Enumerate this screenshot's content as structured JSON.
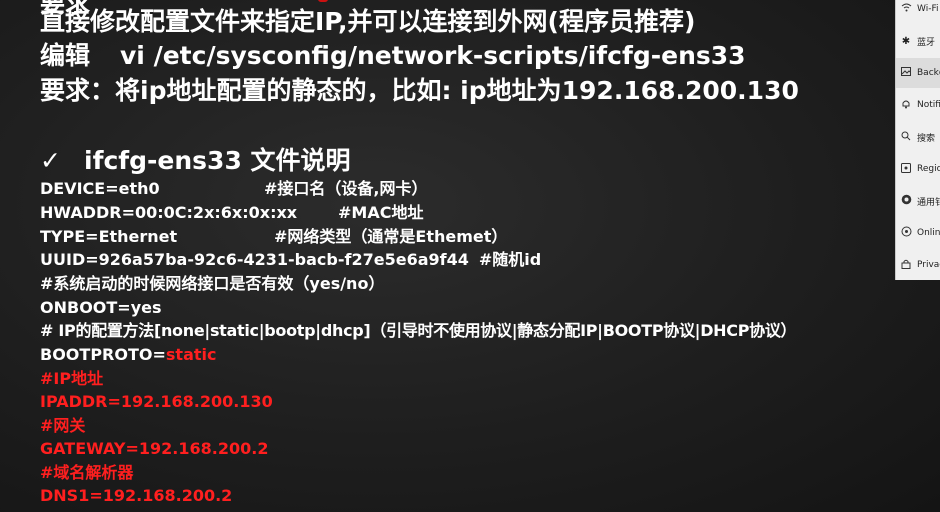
{
  "slide": {
    "top_partial": "要求",
    "line1": "直接修改配置文件来指定IP,并可以连接到外网(程序员推荐)",
    "line2_label": "编辑",
    "line2_value": "vi /etc/sysconfig/network-scripts/ifcfg-ens33",
    "line3": "要求：将ip地址配置的静态的，比如: ip地址为192.168.200.130",
    "check_mark": "✓",
    "section_title": "ifcfg-ens33 文件说明",
    "config": [
      {
        "text": "DEVICE=eth0",
        "comment": "#接口名（设备,网卡）"
      },
      {
        "text": "HWADDR=00:0C:2x:6x:0x:xx",
        "comment": "#MAC地址"
      },
      {
        "text": "TYPE=Ethernet",
        "comment": "#网络类型（通常是Ethemet）"
      },
      {
        "text": "UUID=926a57ba-92c6-4231-bacb-f27e5e6a9f44",
        "comment": "#随机id"
      },
      {
        "text": "#系统启动的时候网络接口是否有效（yes/no）"
      },
      {
        "text": "ONBOOT=yes"
      },
      {
        "text": "# IP的配置方法[none|static|bootp|dhcp]（引导时不使用协议|静态分配IP|BOOTP协议|DHCP协议）"
      },
      {
        "text": "BOOTPROTO=",
        "value_red": "static"
      },
      {
        "text": "#IP地址"
      },
      {
        "text": "IPADDR=192.168.200.130"
      },
      {
        "text": "#网关"
      },
      {
        "text": "GATEWAY=192.168.200.2"
      },
      {
        "text": "#域名解析器"
      },
      {
        "text": "DNS1=192.168.200.2"
      }
    ]
  },
  "panel": {
    "items": [
      {
        "icon": "wifi-icon",
        "label": "Wi-Fi"
      },
      {
        "icon": "bluetooth-icon",
        "label": "蓝牙"
      },
      {
        "icon": "background-icon",
        "label": "Backg"
      },
      {
        "icon": "notification-icon",
        "label": "Notifi"
      },
      {
        "icon": "search-icon",
        "label": "搜索"
      },
      {
        "icon": "region-icon",
        "label": "Regio"
      },
      {
        "icon": "general-icon",
        "label": "通用钅"
      },
      {
        "icon": "online-icon",
        "label": "Onlin"
      },
      {
        "icon": "privacy-icon",
        "label": "Privac"
      }
    ]
  },
  "colors": {
    "text": "#ffffff",
    "accent_red": "#ff1f1f",
    "panel_bg": "#f0f0f0"
  }
}
